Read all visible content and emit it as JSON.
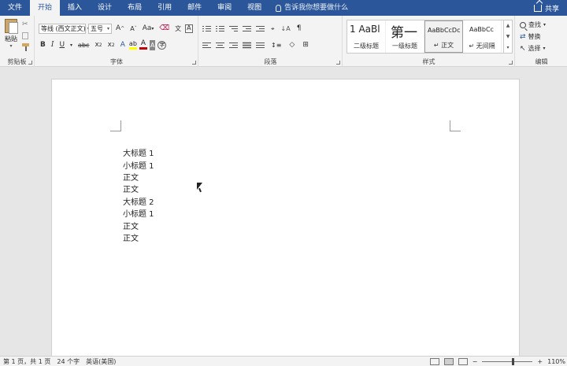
{
  "tabs": [
    "文件",
    "开始",
    "插入",
    "设计",
    "布局",
    "引用",
    "邮件",
    "审阅",
    "视图"
  ],
  "active_tab": "开始",
  "tell_me": "告诉我你想要做什么",
  "share": "共享",
  "clipboard": {
    "paste": "粘贴",
    "label": "剪贴板"
  },
  "font": {
    "label": "字体",
    "name": "等线 (西文正文)",
    "size": "五号",
    "grow": "A",
    "shrink": "A",
    "case": "Aa",
    "bold": "B",
    "italic": "I",
    "underline": "U",
    "strike": "abc",
    "sub": "x",
    "sup": "x",
    "text_effect": "A",
    "font_color": "A",
    "char_shading": "A",
    "char_border": "A",
    "enclose": "字",
    "phonetic": "文",
    "highlight_color": "#ffff00",
    "font_color_value": "#c00000"
  },
  "paragraph": {
    "label": "段落"
  },
  "styles": {
    "label": "样式",
    "items": [
      {
        "sample": "1  AaBl",
        "name": "二级标题"
      },
      {
        "sample": "第一",
        "name": "一级标题"
      },
      {
        "sample": "AaBbCcDc",
        "name": "↵ 正文"
      },
      {
        "sample": "AaBbCc",
        "name": "↵ 无间隔"
      }
    ]
  },
  "editing": {
    "label": "编辑",
    "find": "查找",
    "replace": "替换",
    "select": "选择"
  },
  "document": {
    "paragraphs": [
      "大标题 1",
      "小标题 1",
      "正文",
      "正文",
      "大标题 2",
      "小标题 1",
      "正文",
      "正文"
    ]
  },
  "status": {
    "page": "第 1 页，共 1 页",
    "words": "24 个字",
    "language": "英语(美国)",
    "zoom": "110%",
    "zoom_minus": "−",
    "zoom_plus": "+"
  }
}
